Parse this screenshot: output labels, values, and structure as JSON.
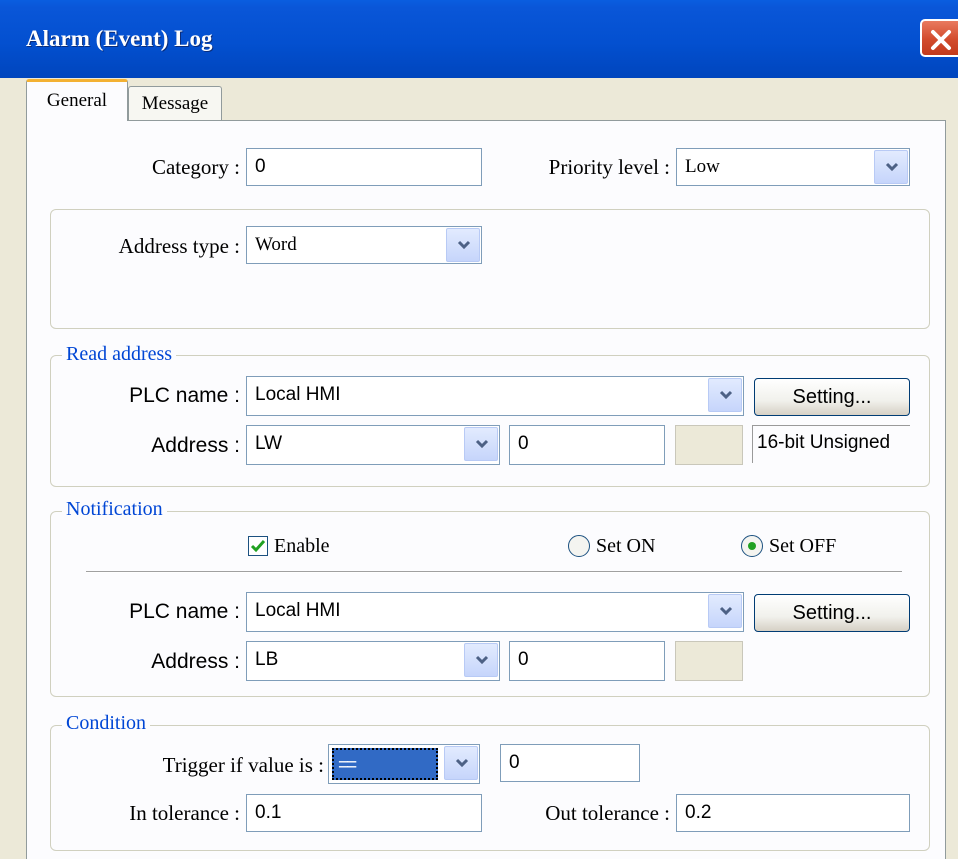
{
  "window": {
    "title": "Alarm (Event) Log"
  },
  "tabs": [
    {
      "label": "General"
    },
    {
      "label": "Message"
    }
  ],
  "general": {
    "category_label": "Category :",
    "category_value": "0",
    "priority_label": "Priority level :",
    "priority_value": "Low",
    "address_type_label": "Address type :",
    "address_type_value": "Word"
  },
  "read_address": {
    "title": "Read address",
    "plc_label": "PLC name :",
    "plc_value": "Local HMI",
    "setting_label": "Setting...",
    "address_label": "Address :",
    "address_device": "LW",
    "address_value": "0",
    "address_extra": "",
    "data_format": "16-bit Unsigned"
  },
  "notification": {
    "title": "Notification",
    "enable_label": "Enable",
    "enable_checked": true,
    "set_on_label": "Set ON",
    "set_off_label": "Set OFF",
    "selected": "Set OFF",
    "plc_label": "PLC name :",
    "plc_value": "Local HMI",
    "setting_label": "Setting...",
    "address_label": "Address :",
    "address_device": "LB",
    "address_value": "0",
    "address_extra": ""
  },
  "condition": {
    "title": "Condition",
    "trigger_label": "Trigger if value is :",
    "trigger_operator": "==",
    "trigger_value": "0",
    "in_tolerance_label": "In tolerance :",
    "in_tolerance_value": "0.1",
    "out_tolerance_label": "Out tolerance :",
    "out_tolerance_value": "0.2"
  },
  "colors": {
    "titlebar": "#0350d0",
    "group_title": "#0046d5",
    "tab_highlight": "#f3b132",
    "close_button": "#d24b2c"
  }
}
